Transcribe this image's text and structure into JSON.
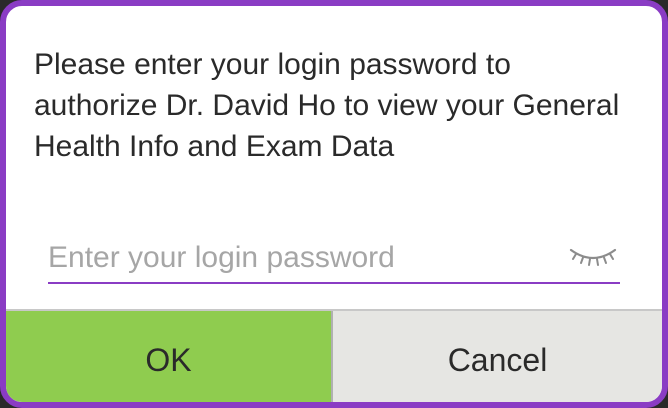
{
  "dialog": {
    "message": "Please enter your login password to authorize Dr. David Ho to view your General Health Info and Exam Data",
    "password_field": {
      "value": "",
      "placeholder": "Enter your login password"
    },
    "visibility_icon": "eye-closed-icon",
    "ok_label": "OK",
    "cancel_label": "Cancel"
  },
  "colors": {
    "accent": "#8a3cc4",
    "ok_button": "#8fcc4f",
    "cancel_button": "#e6e6e3",
    "text": "#2a2a2a",
    "placeholder": "#a6a6a6"
  }
}
